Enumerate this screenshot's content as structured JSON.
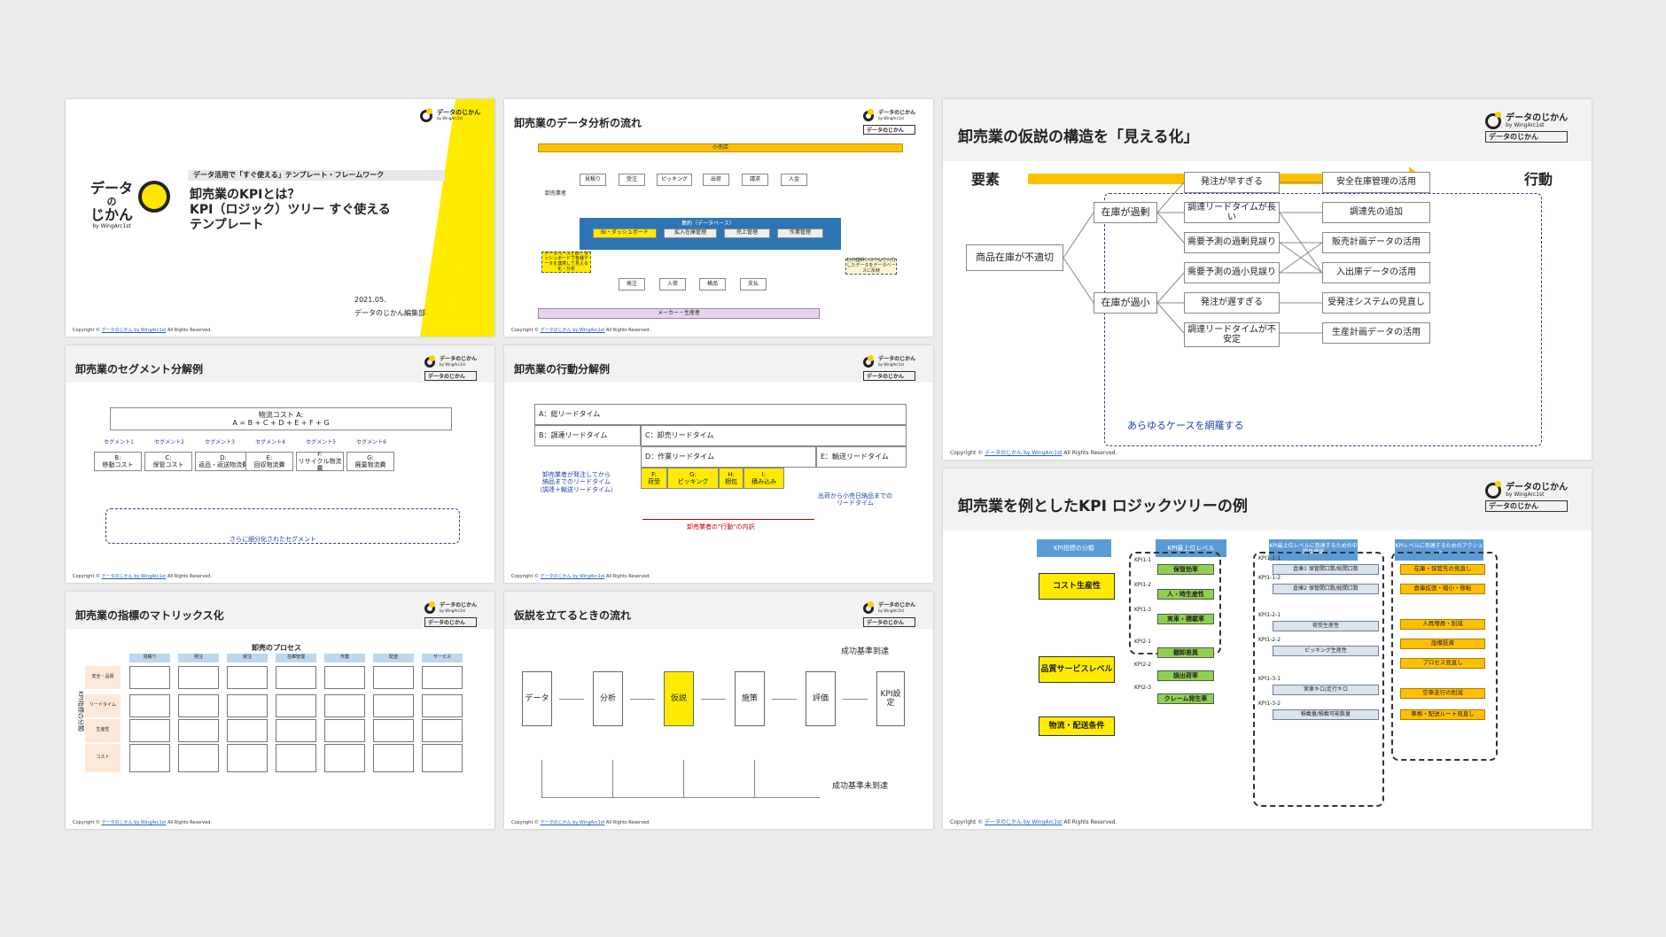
{
  "logo": {
    "text": "データのじかん",
    "by": "by WingArc1st",
    "search": "データのじかん"
  },
  "copyright": {
    "prefix": "Copyright ©",
    "link": "データのじかん by WingArc1st",
    "suffix": " All Rights Reserved."
  },
  "s1": {
    "banner": "データ活用で「すぐ使える」テンプレート・フレームワーク",
    "title1": "卸売業のKPIとは？",
    "title2": "KPI（ロジック）ツリー すぐ使える",
    "title3": "テンプレート",
    "date": "2021.05.",
    "author": "データのじかん編集部",
    "logo_l1": "データ",
    "logo_l2": "の",
    "logo_l3": "じかん",
    "logo_by": "by WingArc1st"
  },
  "s2": {
    "title": "卸売業のデータ分析の流れ",
    "top": "小売店",
    "bottom": "メーカー・生産者",
    "side": "卸売業者",
    "steps_top": [
      "見積り",
      "受注",
      "ピッキング",
      "出荷",
      "請求",
      "入金"
    ],
    "steps_bottom": [
      "発注",
      "入荷",
      "検品",
      "支払"
    ],
    "db": "集約（データベース）",
    "db_items": [
      "BI・ダッシュボード",
      "拡入在庫管理",
      "売上管理",
      "作業管理"
    ],
    "note_left": "データベースとBI・ダッシュボードで各種データを連携して見える化・分析",
    "note_right": "社内基幹システムで入力したデータをデータベースに反映"
  },
  "s3": {
    "title": "卸売業のセグメント分解例",
    "top1": "物流コスト A:",
    "top2": "A = B + C + D + E + F + G",
    "segs": [
      "セグメント1",
      "セグメント2",
      "セグメント3",
      "セグメント4",
      "セグメント5",
      "セグメント6"
    ],
    "items": [
      [
        "B:",
        "移動コスト"
      ],
      [
        "C:",
        "保管コスト"
      ],
      [
        "D:",
        "返品・返送物流費"
      ],
      [
        "E:",
        "回収物流費"
      ],
      [
        "F:",
        "リサイクル物流費"
      ],
      [
        "G:",
        "廃棄物流費"
      ]
    ],
    "caption": "さらに細分化されたセグメント"
  },
  "s4": {
    "title": "卸売業の行動分解例",
    "a": "A：総リードタイム",
    "b": "B：調達リードタイム",
    "c": "C：卸売リードタイム",
    "d": "D：作業リードタイム",
    "e": "E：輸送リードタイム",
    "acts": [
      [
        "F:",
        "荷受"
      ],
      [
        "G:",
        "ピッキング"
      ],
      [
        "H:",
        "梱包"
      ],
      [
        "I:",
        "積み込み"
      ]
    ],
    "note_l1": "卸売業者が発注してから",
    "note_l2": "納品までのリードタイム",
    "note_l3": "（調達＋輸送リードタイム）",
    "note_r1": "出荷から小売日納品までの",
    "note_r2": "リードタイム",
    "caption": "卸売業者の\"行動\"の内訳"
  },
  "s5": {
    "title": "卸売業の指標のマトリックス化",
    "header": "卸売のプロセス",
    "cols": [
      "見積り",
      "発注",
      "受注",
      "在庫管理",
      "作業",
      "配送",
      "サービス"
    ],
    "side": "KPI指標の分類",
    "rows": [
      "安全・品質",
      "リードタイム",
      "生産性",
      "コスト"
    ]
  },
  "s6": {
    "title": "仮説を立てるときの流れ",
    "top_label": "成功基準到達",
    "bottom_label": "成功基準未到達",
    "steps": [
      "データ",
      "分析",
      "仮説",
      "施策",
      "評価",
      "KPI設定"
    ]
  },
  "s7": {
    "title": "卸売業の仮説の構造を「見える化」",
    "left": "要素",
    "right": "行動",
    "root": "商品在庫が不適切",
    "mid": [
      "在庫が過剰",
      "在庫が過小"
    ],
    "causes": [
      "発注が早すぎる",
      "調達リードタイムが長い",
      "需要予測の過剰見誤り",
      "需要予測の過小見誤り",
      "発注が遅すぎる",
      "調達リードタイムが不安定"
    ],
    "actions": [
      "安全在庫管理の活用",
      "調達先の追加",
      "販売計画データの活用",
      "入出庫データの活用",
      "受発注システムの見直し",
      "生産計画データの活用"
    ],
    "caption": "あらゆるケースを網羅する"
  },
  "s8": {
    "title": "卸売業を例としたKPI ロジックツリーの例",
    "h1": "KPI指標の分類",
    "h2": "KPI最上位レベル",
    "h3": "KPI最上位レベルに到達するための中間目標値",
    "h4": "KPIレベルに到達するためのアクション",
    "cats": [
      "コスト生産性",
      "品質サービスレベル",
      "物流・配送条件"
    ],
    "k1": [
      "保管効率",
      "人・時生産性",
      "実車・積載率"
    ],
    "k1c": [
      "KPI1-1",
      "KPI1-2",
      "KPI1-3"
    ],
    "k2": [
      "棚卸差異",
      "誤出荷率",
      "クレーム発生率"
    ],
    "k2c": [
      "KPI2-1",
      "KPI2-2",
      "KPI2-3"
    ],
    "mid": [
      "倉庫1 保管間口数/総間口数",
      "倉庫2 保管間口数/総間口数",
      "荷受生産性",
      "ピッキング生産性",
      "実車キロ/走行キロ",
      "積載量/積載可能数量"
    ],
    "midc": [
      "KPI1-1-1",
      "KPI1-1-2",
      "KPI1-2-1",
      "KPI1-2-2",
      "KPI1-3-1",
      "KPI1-3-2"
    ],
    "acts": [
      "在庫・保管先の見直し",
      "倉庫拡張・縮小・移転",
      "人員増員・削減",
      "設備投資",
      "プロセス見直し",
      "空車走行の削減",
      "車格・配送ルート見直し"
    ]
  }
}
